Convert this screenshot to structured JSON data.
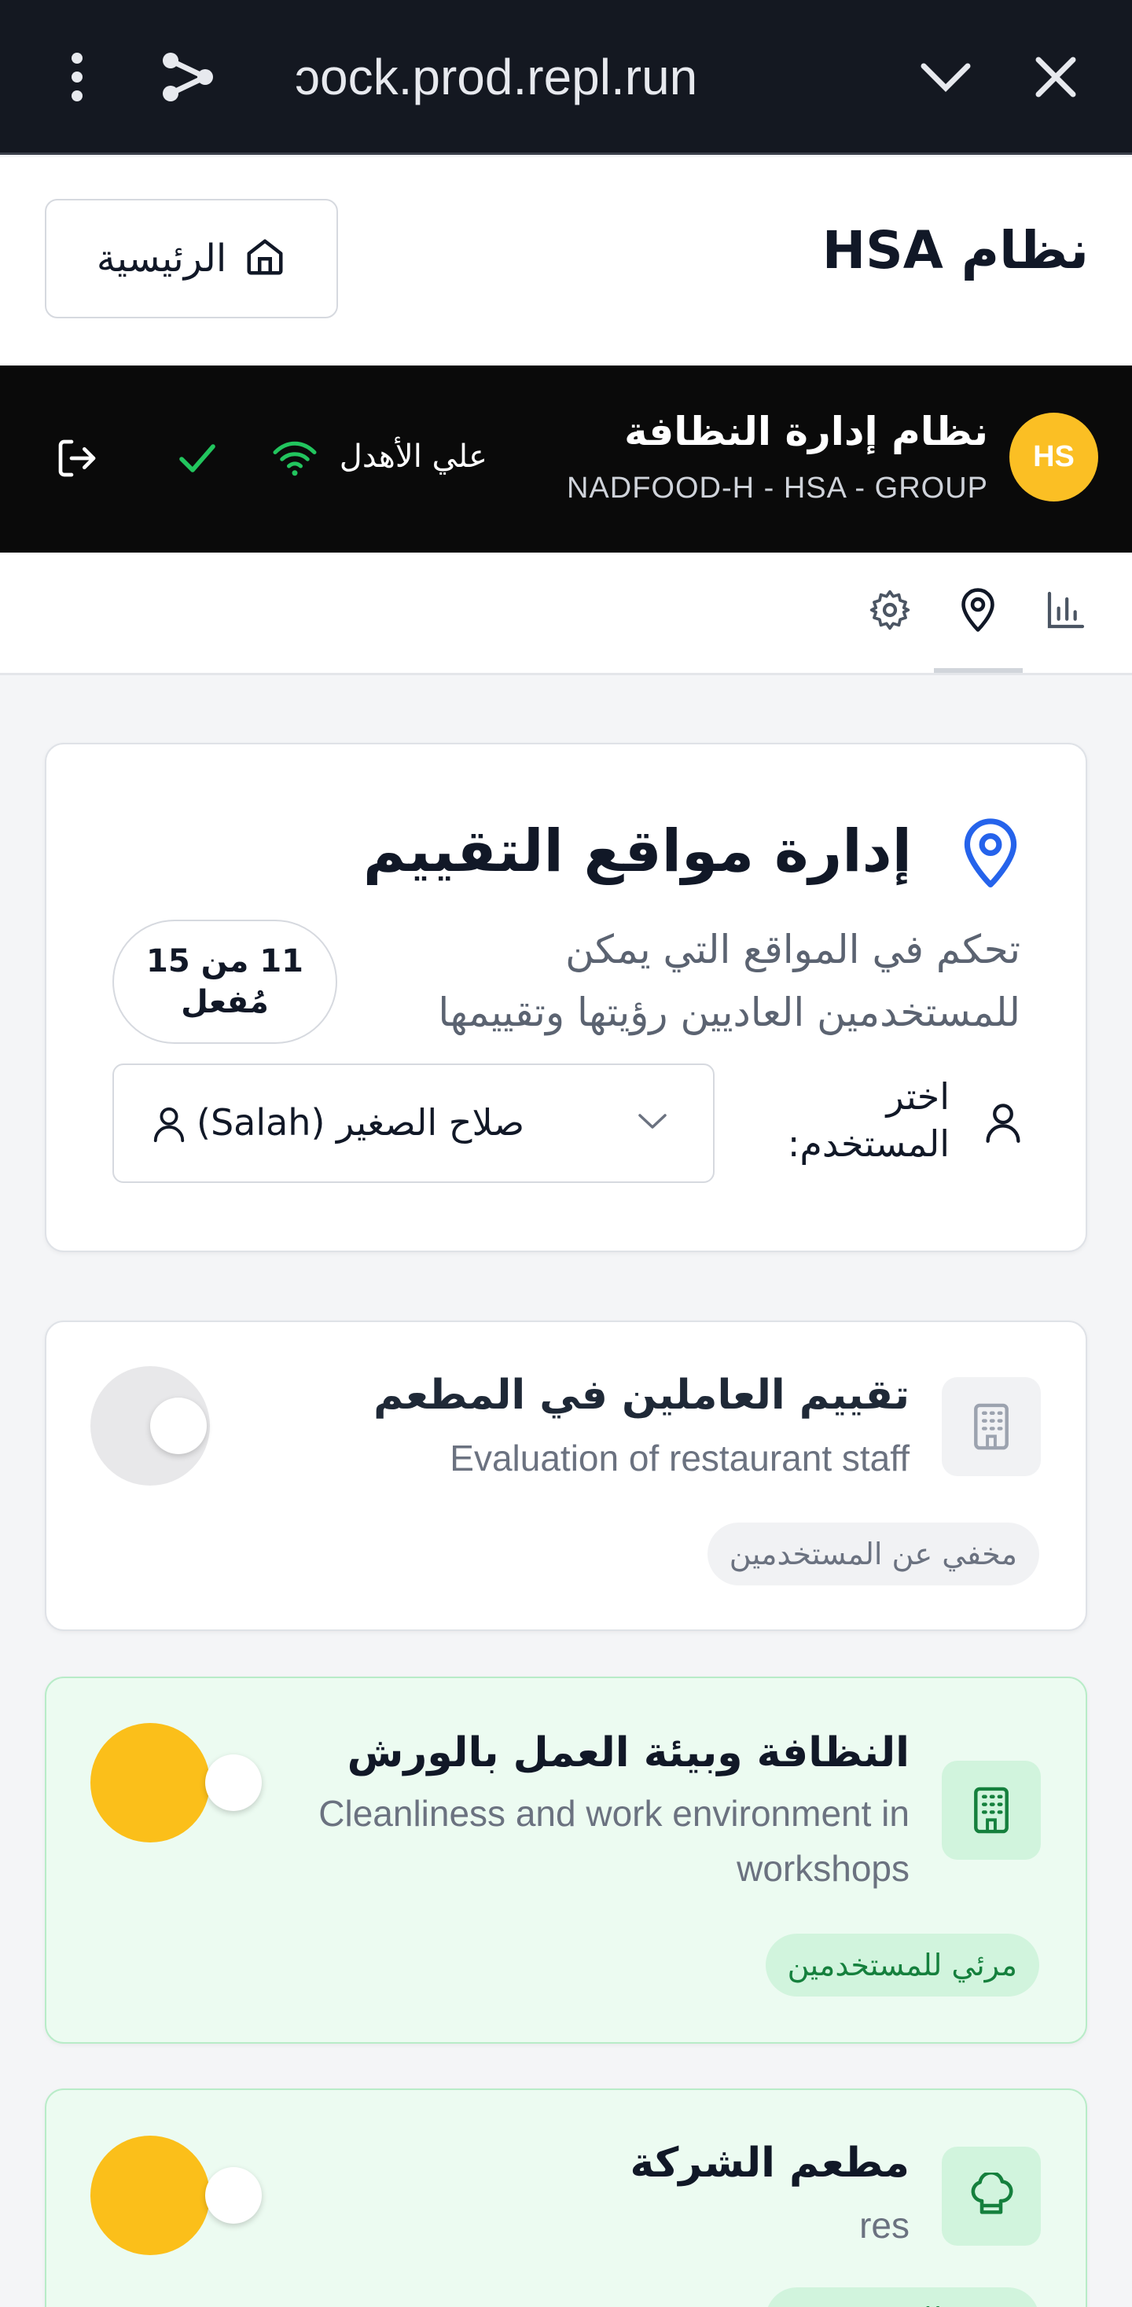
{
  "browser": {
    "url": "ɔock.prod.repl.run"
  },
  "header": {
    "app_title": "نظام HSA",
    "home_label": "الرئيسية"
  },
  "org": {
    "avatar_initials": "HS",
    "name": "نظام إدارة النظافة",
    "subtitle": "NADFOOD-H - HSA - GROUP",
    "online_label": "علي الأهدل"
  },
  "tabs": [
    {
      "name": "stats",
      "icon": "bar-chart-icon"
    },
    {
      "name": "locations",
      "icon": "map-pin-icon",
      "active": true
    },
    {
      "name": "settings",
      "icon": "gear-icon"
    }
  ],
  "locations_panel": {
    "title": "إدارة مواقع التقييم",
    "description": "تحكم في المواقع التي يمكن للمستخدمين العاديين رؤيتها وتقييمها",
    "count_badge": "11 من 15 مُفعل",
    "choose_user_label": "اختر المستخدم:",
    "selected_user": "صلاح الصغير (Salah)"
  },
  "location_items": [
    {
      "title": "تقييم العاملين في المطعم",
      "subtitle": "Evaluation of restaurant staff",
      "status": "مخفي عن المستخدمين",
      "enabled": false,
      "icon": "building-icon"
    },
    {
      "title": "النظافة وبيئة العمل بالورش",
      "subtitle": "Cleanliness and work environment in workshops",
      "status": "مرئي للمستخدمين",
      "enabled": true,
      "icon": "building-icon"
    },
    {
      "title": "مطعم الشركة",
      "subtitle": "res",
      "status": "مرئي للمستخدمين",
      "enabled": true,
      "icon": "chef-hat-icon"
    }
  ],
  "colors": {
    "accent_yellow": "#fbbf1a",
    "success_green": "#22c55e",
    "pin_blue": "#2563eb"
  }
}
